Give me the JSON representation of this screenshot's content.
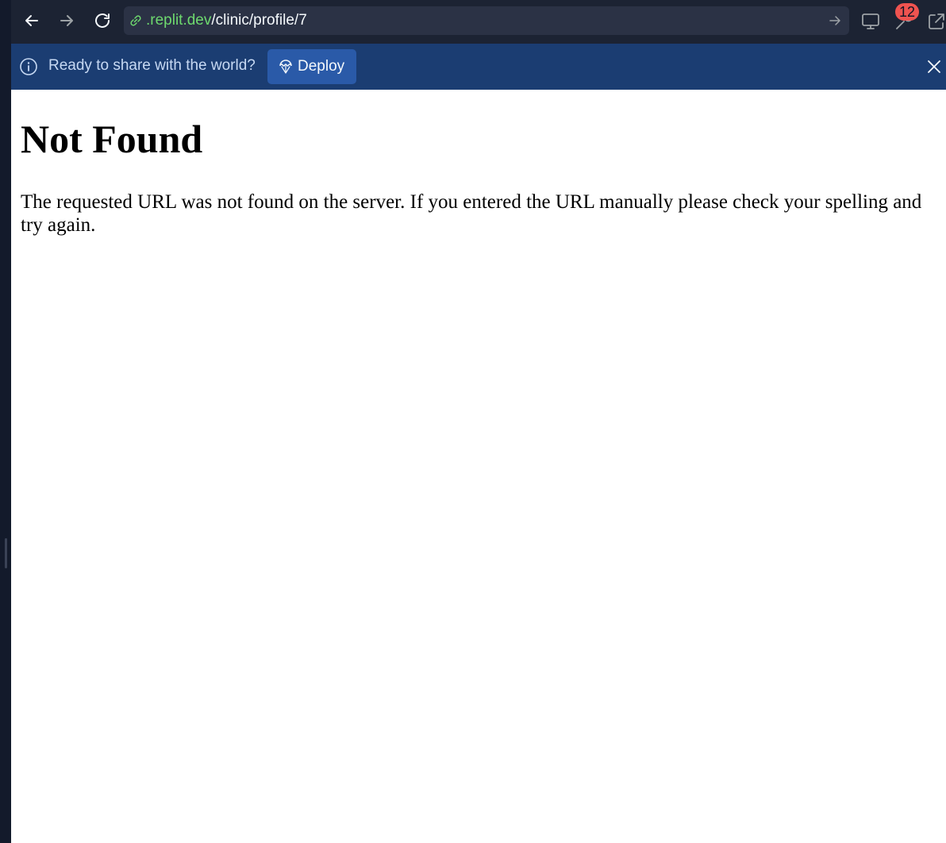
{
  "browser": {
    "url_host": ".replit.dev",
    "url_path": "/clinic/profile/7",
    "notification_count": "12"
  },
  "icons": {
    "back": "arrow-left-icon",
    "forward": "arrow-right-icon",
    "reload": "reload-icon",
    "link": "link-icon",
    "go": "arrow-right-icon",
    "devtools": "monitor-icon",
    "tools": "wrench-icon",
    "open_external": "external-link-icon",
    "info": "info-icon",
    "deploy": "deploy-icon",
    "close": "close-icon"
  },
  "banner": {
    "message": "Ready to share with the world?",
    "deploy_label": "Deploy"
  },
  "page": {
    "heading": "Not Found",
    "message": "The requested URL was not found on the server. If you entered the URL manually please check your spelling and try again."
  },
  "colors": {
    "toolbar_bg": "#1c2333",
    "url_host": "#6ed96e",
    "banner_bg": "#1b3d72",
    "deploy_button_bg": "#2a5aa8",
    "badge_bg": "#ef5350"
  }
}
